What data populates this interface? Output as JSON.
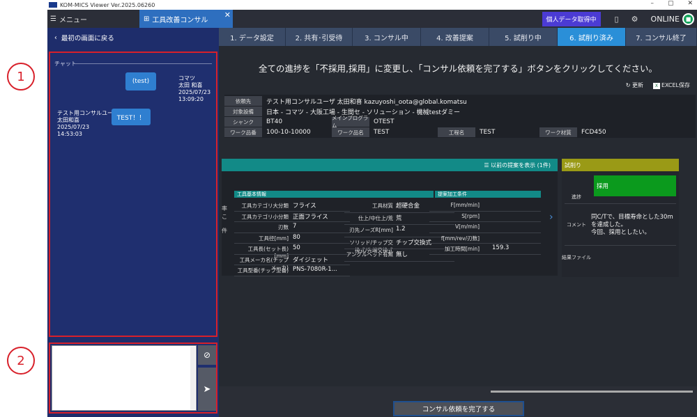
{
  "window": {
    "title": "KOM-MICS Viewer  Ver.2025.06260",
    "controls": [
      "–",
      "▢",
      "✕"
    ]
  },
  "appbar": {
    "menu_tab": "メニュー",
    "active_tab": "工具改善コンサル",
    "close": "✕",
    "personal_btn": "個人データ取得中",
    "online": "ONLINE"
  },
  "left": {
    "back": "最初の画面に戻る",
    "chat_title": "チャット",
    "messages": [
      {
        "text": "(test)",
        "user": "コマツ",
        "name": "太田 和喜",
        "date": "2025/07/23",
        "time": "13:09:20"
      },
      {
        "text": "TEST！！",
        "user": "テスト用コンサルユーｻ",
        "name": "太田和喜",
        "date": "2025/07/23",
        "time": "14:53:03"
      }
    ],
    "input_placeholder": ""
  },
  "callouts": [
    "1",
    "2"
  ],
  "steps": [
    {
      "label": "1. データ設定",
      "active": false
    },
    {
      "label": "2. 共有･引受待",
      "active": false
    },
    {
      "label": "3. コンサル中",
      "active": false
    },
    {
      "label": "4. 改善提案",
      "active": false
    },
    {
      "label": "5. 試削り中",
      "active": false
    },
    {
      "label": "6. 試削り済み",
      "active": true
    },
    {
      "label": "7. コンサル終了",
      "active": false
    }
  ],
  "instruction": "全ての進捗を「不採用,採用」に変更し、「コンサル依頼を完了する」ボタンをクリックしてください。",
  "tools": {
    "refresh": "更新",
    "excel": "EXCEL保存"
  },
  "info": {
    "client_lbl": "依頼先",
    "client_val": "テスト用コンサルユーザ  太田和喜  kazuyoshi_oota@global.komatsu",
    "equip_lbl": "対象設備",
    "equip_val": "日本 - コマツ - 大阪工場 - 生間セ - ソリューション - 機械testダミー",
    "shank_lbl": "シャンク",
    "shank_val": "BT40",
    "prog_lbl": "メインプログラム",
    "prog_val": "OTEST",
    "work_no_lbl": "ワーク品番",
    "work_no_val": "100-10-10000",
    "work_name_lbl": "ワーク品名",
    "work_name_val": "TEST",
    "proc_lbl": "工程名",
    "proc_val": "TEST",
    "mat_lbl": "ワーク材質",
    "mat_val": "FCD450"
  },
  "proposal": {
    "show_prev": "以前の提案を表示 (1件)",
    "left_fragments": [
      "率",
      "こ",
      "件"
    ],
    "basic_title": "工具基本情報",
    "cond_title": "提案加工条件",
    "basic_left": [
      {
        "label": "工具カテゴリ大分類",
        "value": "フライス"
      },
      {
        "label": "工具カテゴリ小分類",
        "value": "正面フライス"
      },
      {
        "label": "刃数",
        "value": "7"
      },
      {
        "label": "工具径[mm]",
        "value": "80"
      },
      {
        "label": "工具長(セット長)[mm]",
        "value": "50"
      },
      {
        "label": "工具メーカ名(チップメーカ)",
        "value": "ダイジェット"
      },
      {
        "label": "工具型番(チップ型番)",
        "value": "PNS-7080R-1..."
      }
    ],
    "basic_right": [
      {
        "label": "工具材質",
        "value": "超硬合金"
      },
      {
        "label": "仕上/中仕上/荒",
        "value": "荒"
      },
      {
        "label": "刃先ノーズR[mm]",
        "value": "1.2"
      },
      {
        "label": "ソリッド/チップ交換式/先端交換式",
        "value": "チップ交換式"
      },
      {
        "label": "アングルヘッド有無",
        "value": "無し"
      }
    ],
    "cond": [
      {
        "label": "F[mm/min]",
        "value": ""
      },
      {
        "label": "S[rpm]",
        "value": ""
      },
      {
        "label": "V[m/min]",
        "value": ""
      },
      {
        "label": "f[mm/rev/刃数]",
        "value": ""
      },
      {
        "label": "加工時間[min]",
        "value": "159.3"
      }
    ]
  },
  "trial": {
    "title": "試削り",
    "progress_lbl": "進捗",
    "progress_val": "採用",
    "comment_lbl": "コメント",
    "comment_lines": [
      "同C/Tで、目標寿命とした30m",
      "を達成した。",
      "今回、採用としたい。"
    ],
    "result_lbl": "結果ファイル"
  },
  "footer": {
    "complete_btn": "コンサル依頼を完了する"
  },
  "colors": {
    "accent": "#2a8fd8",
    "teal": "#128a87",
    "olive": "#9a9a16",
    "green": "#0b9a1d",
    "callout": "#d8202a"
  }
}
